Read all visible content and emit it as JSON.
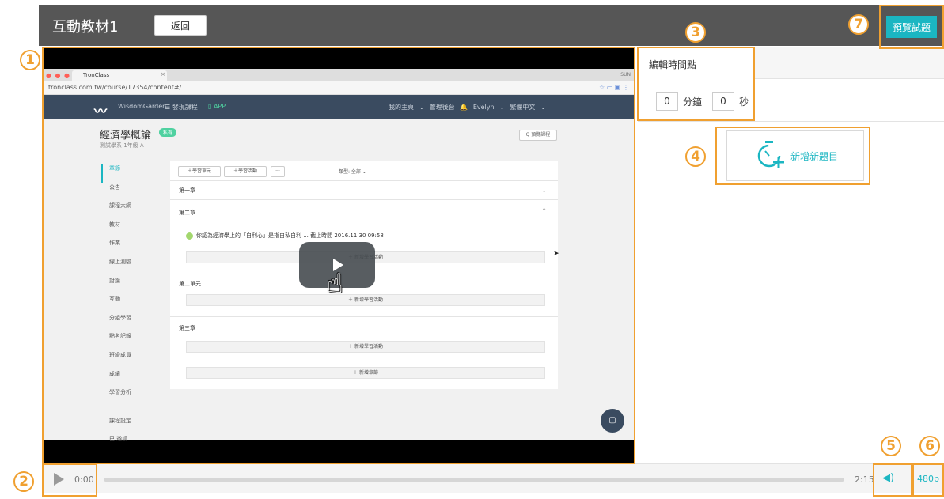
{
  "header": {
    "title": "互動教材1",
    "back_label": "返回",
    "preview_label": "預覽試題"
  },
  "video_preview": {
    "browser_tab": "TronClass",
    "browser_user": "SUN",
    "url": "tronclass.com.tw/course/17354/content#/",
    "nav": {
      "brand": "WisdomGarden",
      "course_menu": "☰ 發現課程",
      "app": "▯ APP",
      "right": "我的主頁 ⌄  管理後台  🔔  Evelyn ⌄  繁體中文 ⌄"
    },
    "course_title": "經濟學概論",
    "course_tag": "私有",
    "course_subtitle": "測試學系 1年級 A",
    "preview_button": "Q 預覽課程",
    "sidebar": [
      "章節",
      "公告",
      "課程大綱",
      "教材",
      "作業",
      "線上測驗",
      "討論",
      "互動",
      "分組學習",
      "點名記錄",
      "班級成員",
      "成績",
      "學習分析",
      "課程設定",
      "巴 邀請"
    ],
    "toolbar": {
      "add_unit": "＋學習單元",
      "add_activity": "＋學習活動",
      "more": "···",
      "type_label": "類型: 全部 ⌄"
    },
    "chapter1": "第一章",
    "chapter2": "第二章",
    "activity_text": "你認為經濟學上的「自利心」是指自私自利 ... 截止時間 2016.11.30 09:58",
    "add_activity_bar": "＋ 新增學習活動",
    "unit2": "第二單元",
    "chapter3": "第三章",
    "add_chapter_bar": "＋ 新增章節"
  },
  "edit_panel": {
    "title": "編輯時間點",
    "minutes_value": "0",
    "minutes_label": "分鐘",
    "seconds_value": "0",
    "seconds_label": "秒"
  },
  "add_question": {
    "label": "新增新題目",
    "icon": "stopwatch-plus-icon"
  },
  "controls": {
    "current_time": "0:00",
    "duration": "2:15",
    "volume_icon": "speaker-icon",
    "quality": "480p"
  },
  "annotations": [
    "1",
    "2",
    "3",
    "4",
    "5",
    "6",
    "7"
  ],
  "colors": {
    "accent": "#1bb6c2",
    "annotation": "#f0a030",
    "header_bg": "#565656"
  }
}
